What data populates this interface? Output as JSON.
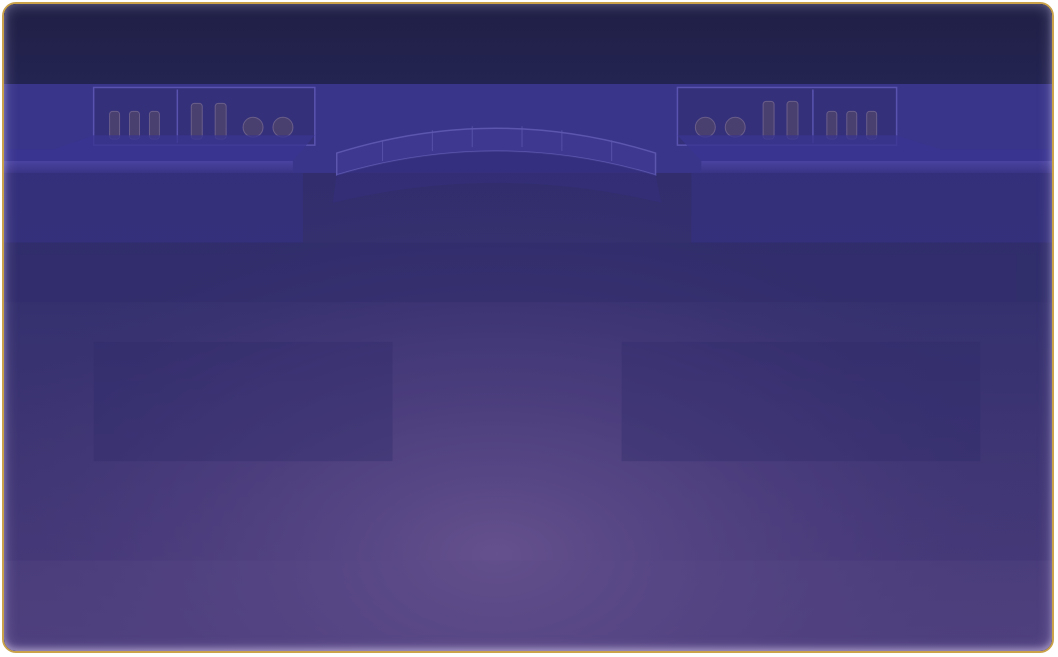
{
  "scene": {
    "name": "bar-backdrop",
    "shelf_left_items": [
      "bottle",
      "bottle",
      "bottle",
      "bottle",
      "bottle",
      "glass",
      "glass"
    ],
    "shelf_right_items": [
      "glass",
      "glass",
      "bottle",
      "bottle",
      "bottle",
      "bottle",
      "bottle"
    ]
  },
  "colors": {
    "frame_border": "#c9a24a",
    "title_bar": "#22224c",
    "wall": "#2f2c6a",
    "floor_glow": "#5d4a8c"
  }
}
